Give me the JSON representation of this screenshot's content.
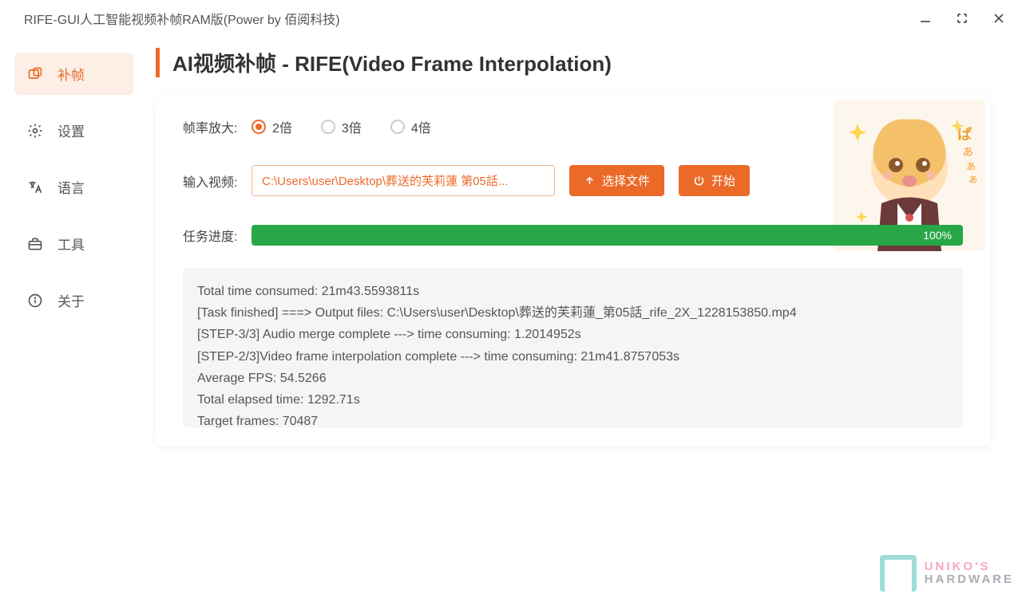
{
  "window": {
    "title": "RIFE-GUI人工智能视频补帧RAM版(Power by 佰阅科技)"
  },
  "sidebar": {
    "items": [
      {
        "label": "补帧",
        "icon": "interpolate-icon",
        "active": true
      },
      {
        "label": "设置",
        "icon": "gear-icon",
        "active": false
      },
      {
        "label": "语言",
        "icon": "translate-icon",
        "active": false
      },
      {
        "label": "工具",
        "icon": "toolbox-icon",
        "active": false
      },
      {
        "label": "关于",
        "icon": "info-icon",
        "active": false
      }
    ]
  },
  "page": {
    "title": "AI视频补帧 - RIFE(Video Frame Interpolation)"
  },
  "frame_rate": {
    "label": "帧率放大:",
    "options": [
      "2倍",
      "3倍",
      "4倍"
    ],
    "selected": "2倍"
  },
  "input_video": {
    "label": "输入视频:",
    "path": "C:\\Users\\user\\Desktop\\葬送的芙莉蓮 第05話...",
    "select_btn": "选择文件",
    "start_btn": "开始"
  },
  "progress": {
    "label": "任务进度:",
    "percent": "100%"
  },
  "log": {
    "lines": [
      "Total time consumed: 21m43.5593811s",
      "[Task finished] ===> Output files: C:\\Users\\user\\Desktop\\葬送的芙莉蓮_第05話_rife_2X_1228153850.mp4",
      "[STEP-3/3] Audio merge complete ---> time consuming: 1.2014952s",
      "[STEP-2/3]Video frame interpolation complete ---> time consuming: 21m41.8757053s",
      "Average FPS: 54.5266",
      "Total elapsed time: 1292.71s",
      "Target frames: 70487"
    ]
  },
  "watermark": {
    "line1": "UNIKO'S",
    "line2": "HARDWARE"
  }
}
